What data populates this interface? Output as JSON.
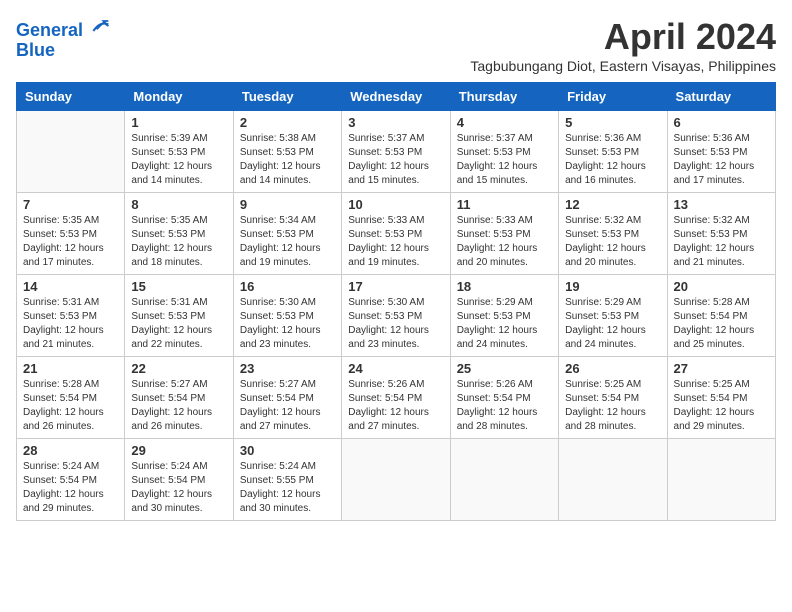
{
  "logo": {
    "line1": "General",
    "line2": "Blue"
  },
  "title": "April 2024",
  "subtitle": "Tagbubungang Diot, Eastern Visayas, Philippines",
  "days_of_week": [
    "Sunday",
    "Monday",
    "Tuesday",
    "Wednesday",
    "Thursday",
    "Friday",
    "Saturday"
  ],
  "weeks": [
    [
      {
        "day": null
      },
      {
        "day": 1,
        "sunrise": "5:39 AM",
        "sunset": "5:53 PM",
        "daylight": "12 hours and 14 minutes."
      },
      {
        "day": 2,
        "sunrise": "5:38 AM",
        "sunset": "5:53 PM",
        "daylight": "12 hours and 14 minutes."
      },
      {
        "day": 3,
        "sunrise": "5:37 AM",
        "sunset": "5:53 PM",
        "daylight": "12 hours and 15 minutes."
      },
      {
        "day": 4,
        "sunrise": "5:37 AM",
        "sunset": "5:53 PM",
        "daylight": "12 hours and 15 minutes."
      },
      {
        "day": 5,
        "sunrise": "5:36 AM",
        "sunset": "5:53 PM",
        "daylight": "12 hours and 16 minutes."
      },
      {
        "day": 6,
        "sunrise": "5:36 AM",
        "sunset": "5:53 PM",
        "daylight": "12 hours and 17 minutes."
      }
    ],
    [
      {
        "day": 7,
        "sunrise": "5:35 AM",
        "sunset": "5:53 PM",
        "daylight": "12 hours and 17 minutes."
      },
      {
        "day": 8,
        "sunrise": "5:35 AM",
        "sunset": "5:53 PM",
        "daylight": "12 hours and 18 minutes."
      },
      {
        "day": 9,
        "sunrise": "5:34 AM",
        "sunset": "5:53 PM",
        "daylight": "12 hours and 19 minutes."
      },
      {
        "day": 10,
        "sunrise": "5:33 AM",
        "sunset": "5:53 PM",
        "daylight": "12 hours and 19 minutes."
      },
      {
        "day": 11,
        "sunrise": "5:33 AM",
        "sunset": "5:53 PM",
        "daylight": "12 hours and 20 minutes."
      },
      {
        "day": 12,
        "sunrise": "5:32 AM",
        "sunset": "5:53 PM",
        "daylight": "12 hours and 20 minutes."
      },
      {
        "day": 13,
        "sunrise": "5:32 AM",
        "sunset": "5:53 PM",
        "daylight": "12 hours and 21 minutes."
      }
    ],
    [
      {
        "day": 14,
        "sunrise": "5:31 AM",
        "sunset": "5:53 PM",
        "daylight": "12 hours and 21 minutes."
      },
      {
        "day": 15,
        "sunrise": "5:31 AM",
        "sunset": "5:53 PM",
        "daylight": "12 hours and 22 minutes."
      },
      {
        "day": 16,
        "sunrise": "5:30 AM",
        "sunset": "5:53 PM",
        "daylight": "12 hours and 23 minutes."
      },
      {
        "day": 17,
        "sunrise": "5:30 AM",
        "sunset": "5:53 PM",
        "daylight": "12 hours and 23 minutes."
      },
      {
        "day": 18,
        "sunrise": "5:29 AM",
        "sunset": "5:53 PM",
        "daylight": "12 hours and 24 minutes."
      },
      {
        "day": 19,
        "sunrise": "5:29 AM",
        "sunset": "5:53 PM",
        "daylight": "12 hours and 24 minutes."
      },
      {
        "day": 20,
        "sunrise": "5:28 AM",
        "sunset": "5:54 PM",
        "daylight": "12 hours and 25 minutes."
      }
    ],
    [
      {
        "day": 21,
        "sunrise": "5:28 AM",
        "sunset": "5:54 PM",
        "daylight": "12 hours and 26 minutes."
      },
      {
        "day": 22,
        "sunrise": "5:27 AM",
        "sunset": "5:54 PM",
        "daylight": "12 hours and 26 minutes."
      },
      {
        "day": 23,
        "sunrise": "5:27 AM",
        "sunset": "5:54 PM",
        "daylight": "12 hours and 27 minutes."
      },
      {
        "day": 24,
        "sunrise": "5:26 AM",
        "sunset": "5:54 PM",
        "daylight": "12 hours and 27 minutes."
      },
      {
        "day": 25,
        "sunrise": "5:26 AM",
        "sunset": "5:54 PM",
        "daylight": "12 hours and 28 minutes."
      },
      {
        "day": 26,
        "sunrise": "5:25 AM",
        "sunset": "5:54 PM",
        "daylight": "12 hours and 28 minutes."
      },
      {
        "day": 27,
        "sunrise": "5:25 AM",
        "sunset": "5:54 PM",
        "daylight": "12 hours and 29 minutes."
      }
    ],
    [
      {
        "day": 28,
        "sunrise": "5:24 AM",
        "sunset": "5:54 PM",
        "daylight": "12 hours and 29 minutes."
      },
      {
        "day": 29,
        "sunrise": "5:24 AM",
        "sunset": "5:54 PM",
        "daylight": "12 hours and 30 minutes."
      },
      {
        "day": 30,
        "sunrise": "5:24 AM",
        "sunset": "5:55 PM",
        "daylight": "12 hours and 30 minutes."
      },
      {
        "day": null
      },
      {
        "day": null
      },
      {
        "day": null
      },
      {
        "day": null
      }
    ]
  ],
  "labels": {
    "sunrise": "Sunrise:",
    "sunset": "Sunset:",
    "daylight": "Daylight:"
  }
}
